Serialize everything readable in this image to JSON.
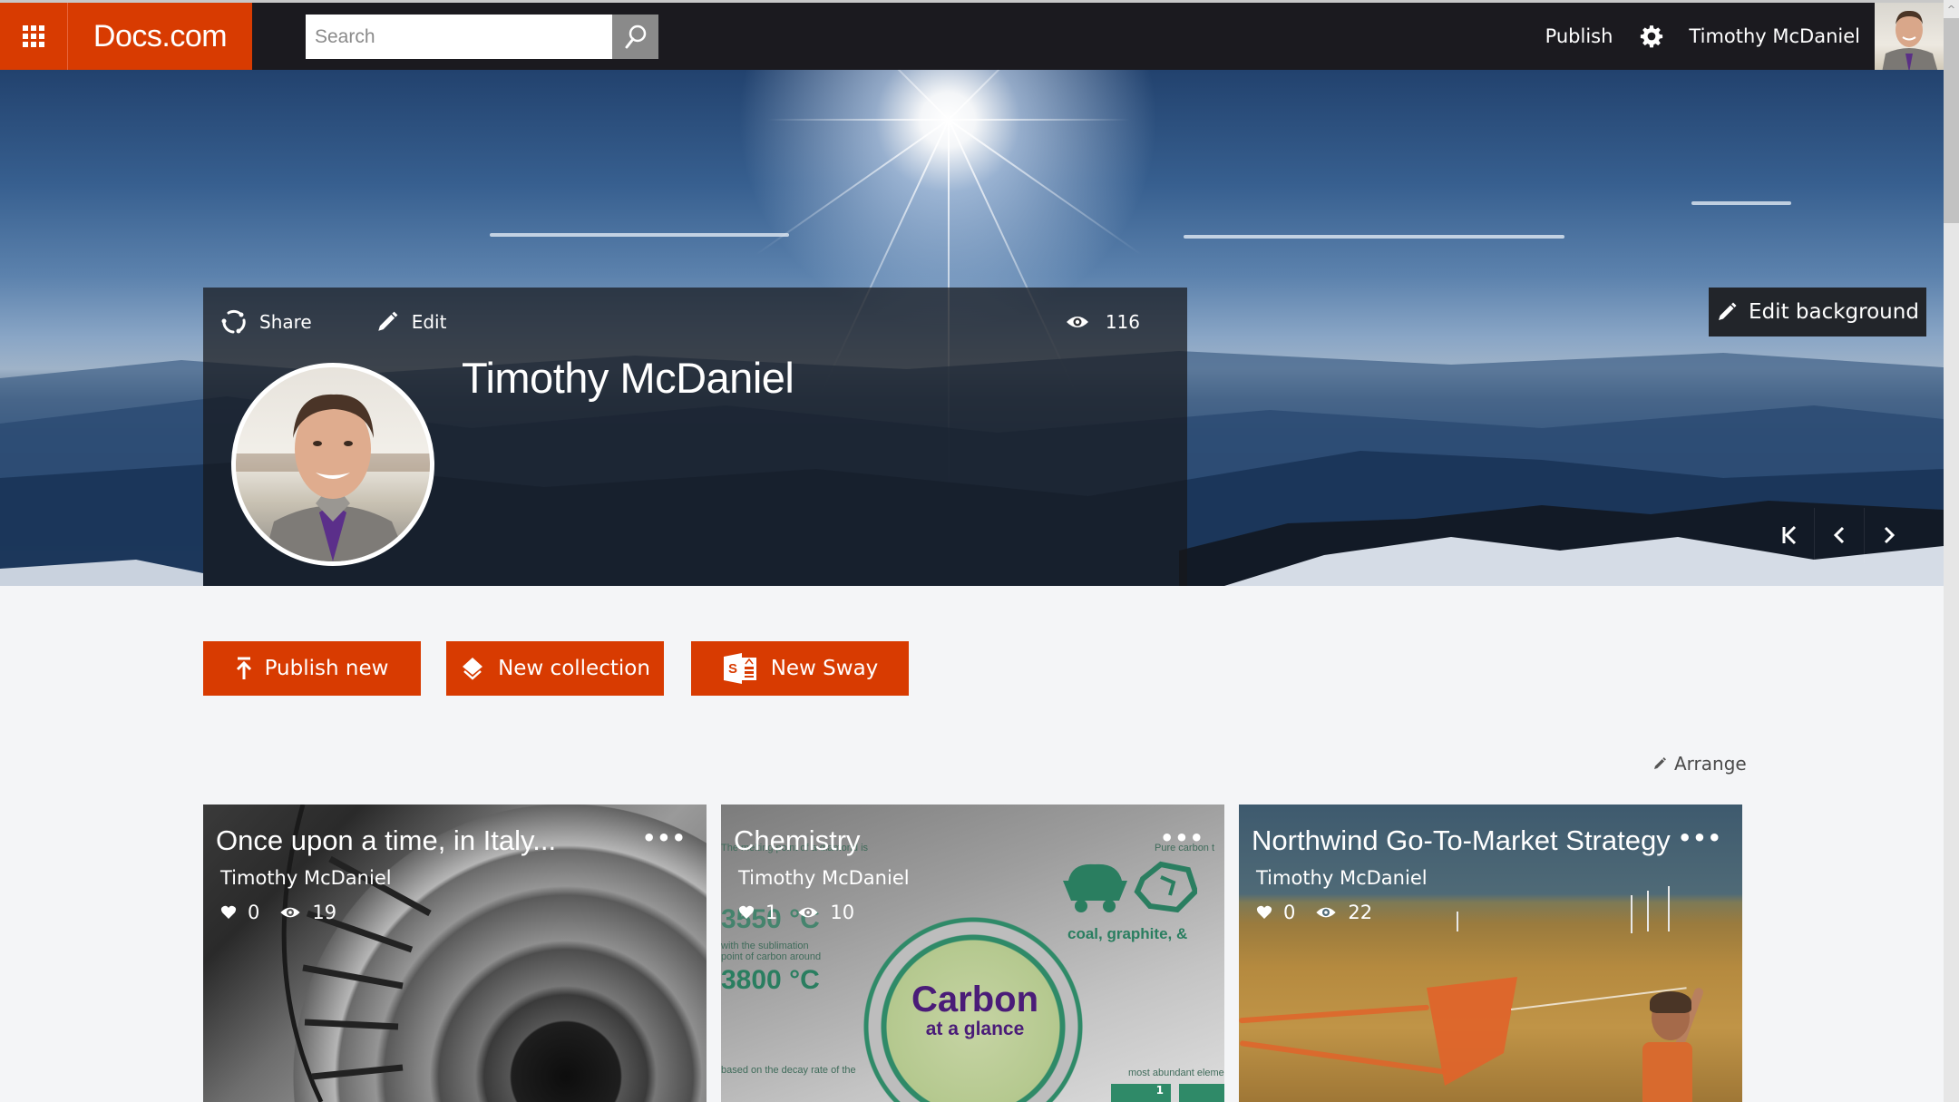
{
  "topbar": {
    "app_launcher_icon": "waffle-grid-icon",
    "brand": "Docs.com",
    "search": {
      "placeholder": "Search",
      "value": "",
      "icon": "search-icon"
    },
    "publish_label": "Publish",
    "settings_icon": "gear-icon",
    "user_name": "Timothy McDaniel",
    "avatar_icon": "user-avatar"
  },
  "hero": {
    "profile": {
      "share_label": "Share",
      "edit_label": "Edit",
      "views_icon": "eye-icon",
      "views": "116",
      "name": "Timothy McDaniel"
    },
    "edit_background_label": "Edit background",
    "nav": [
      {
        "icon": "skip-first-icon",
        "glyph": "K"
      },
      {
        "icon": "chevron-left-icon",
        "glyph": "‹"
      },
      {
        "icon": "chevron-right-icon",
        "glyph": "›"
      }
    ]
  },
  "actions": [
    {
      "label": "Publish new",
      "icon": "upload-icon"
    },
    {
      "label": "New collection",
      "icon": "collection-icon"
    },
    {
      "label": "New Sway",
      "icon": "sway-icon"
    }
  ],
  "arrange_label": "Arrange",
  "cards": [
    {
      "title": "Once upon a time, in Italy...",
      "author": "Timothy McDaniel",
      "likes": "0",
      "views": "19",
      "more": "•••"
    },
    {
      "title": "Chemistry",
      "author": "Timothy McDaniel",
      "likes": "1",
      "views": "10",
      "more": "•••",
      "artwork": {
        "headline": "Carbon",
        "subhead": "at a glance",
        "stat1": "3550 °C",
        "stat2": "3800 °C",
        "caption1": "The melting point of a diamond is",
        "caption2": "with the sublimation point of carbon around",
        "caption3": "based on the decay rate of the",
        "caption4": "coal, graphite, &",
        "caption5": "Pure carbon t",
        "caption6": "most abundant eleme",
        "box1": "1"
      }
    },
    {
      "title": "Northwind Go-To-Market Strategy",
      "author": "Timothy McDaniel",
      "likes": "0",
      "views": "22",
      "more": "•••"
    }
  ],
  "colors": {
    "brand": "#d83b01",
    "topbar": "#1b1a1f",
    "page_bg": "#f4f5f7",
    "panel": "#16181c"
  }
}
